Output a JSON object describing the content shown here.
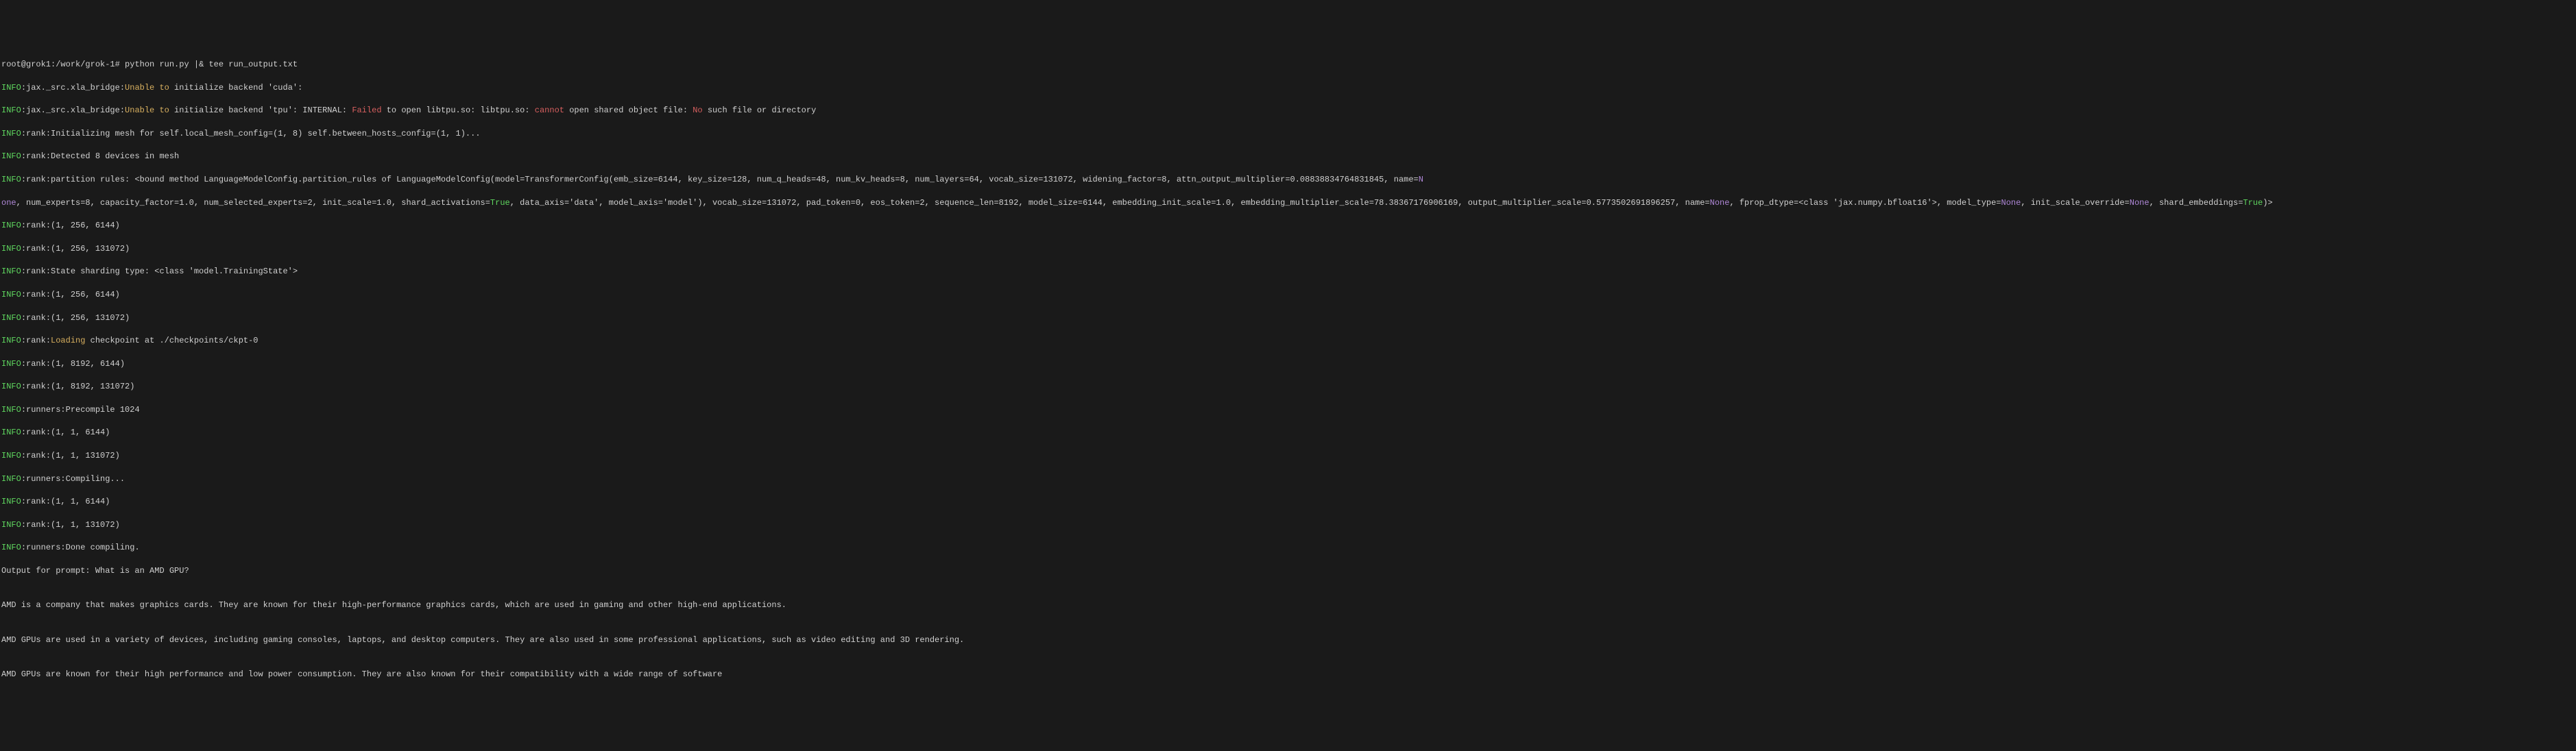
{
  "prompt": {
    "user_host": "root@grok1",
    "path": ":/work/grok-1#",
    "command": " python run.py |& tee run_output.txt"
  },
  "lines": {
    "l1_info": "INFO",
    "l1_mod": ":jax._src.xla_bridge:",
    "l1_warn": "Unable to",
    "l1_rest": " initialize backend 'cuda':",
    "l2_info": "INFO",
    "l2_mod": ":jax._src.xla_bridge:",
    "l2_warn": "Unable to",
    "l2_mid1": " initialize backend 'tpu': INTERNAL: ",
    "l2_fail": "Failed",
    "l2_mid2": " to open libtpu.so: libtpu.so: ",
    "l2_cannot": "cannot",
    "l2_mid3": " open shared object file: ",
    "l2_no": "No",
    "l2_rest": " such file or directory",
    "l3_info": "INFO",
    "l3_text": ":rank:Initializing mesh for self.local_mesh_config=(1, 8) self.between_hosts_config=(1, 1)...",
    "l4_info": "INFO",
    "l4_text": ":rank:Detected 8 devices in mesh",
    "l5_info": "INFO",
    "l5_a": ":rank:partition rules: <bound method LanguageModelConfig.partition_rules of LanguageModelConfig(model=TransformerConfig(emb_size=6144, key_size=128, num_q_heads=48, num_kv_heads=8, num_layers=64, vocab_size=131072, widening_factor=8, attn_output_multiplier=0.08838834764831845, name=",
    "l5_n": "N",
    "l6_one": "one",
    "l6_a": ", num_experts=8, capacity_factor=1.0, num_selected_experts=2, init_scale=1.0, shard_activations=",
    "l6_true1": "True",
    "l6_b": ", data_axis='data', model_axis='model'), vocab_size=131072, pad_token=0, eos_token=2, sequence_len=8192, model_size=6144, embedding_init_scale=1.0, embedding_multiplier_scale=78.38367176906169, output_multiplier_scale=0.5773502691896257, name=",
    "l6_none1": "None",
    "l6_c": ", fprop_dtype=<class 'jax.numpy.bfloat16'>, model_type=",
    "l6_none2": "None",
    "l6_d": ", init_scale_override=",
    "l6_none3": "None",
    "l6_e": ", shard_embeddings=",
    "l6_true2": "True",
    "l6_f": ")>",
    "l7_info": "INFO",
    "l7_text": ":rank:(1, 256, 6144)",
    "l8_info": "INFO",
    "l8_text": ":rank:(1, 256, 131072)",
    "l9_info": "INFO",
    "l9_text": ":rank:State sharding type: <class 'model.TrainingState'>",
    "l10_info": "INFO",
    "l10_text": ":rank:(1, 256, 6144)",
    "l11_info": "INFO",
    "l11_text": ":rank:(1, 256, 131072)",
    "l12_info": "INFO",
    "l12_a": ":rank:",
    "l12_loading": "Loading",
    "l12_b": " checkpoint at ./checkpoints/ckpt-0",
    "l13_info": "INFO",
    "l13_text": ":rank:(1, 8192, 6144)",
    "l14_info": "INFO",
    "l14_text": ":rank:(1, 8192, 131072)",
    "l15_info": "INFO",
    "l15_text": ":runners:Precompile 1024",
    "l16_info": "INFO",
    "l16_text": ":rank:(1, 1, 6144)",
    "l17_info": "INFO",
    "l17_text": ":rank:(1, 1, 131072)",
    "l18_info": "INFO",
    "l18_text": ":runners:Compiling...",
    "l19_info": "INFO",
    "l19_text": ":rank:(1, 1, 6144)",
    "l20_info": "INFO",
    "l20_text": ":rank:(1, 1, 131072)",
    "l21_info": "INFO",
    "l21_text": ":runners:Done compiling.",
    "output_prompt": "Output for prompt: What is an AMD GPU?",
    "blank": "",
    "out1": "AMD is a company that makes graphics cards. They are known for their high-performance graphics cards, which are used in gaming and other high-end applications.",
    "out2": "AMD GPUs are used in a variety of devices, including gaming consoles, laptops, and desktop computers. They are also used in some professional applications, such as video editing and 3D rendering.",
    "out3": "AMD GPUs are known for their high performance and low power consumption. They are also known for their compatibility with a wide range of software"
  }
}
